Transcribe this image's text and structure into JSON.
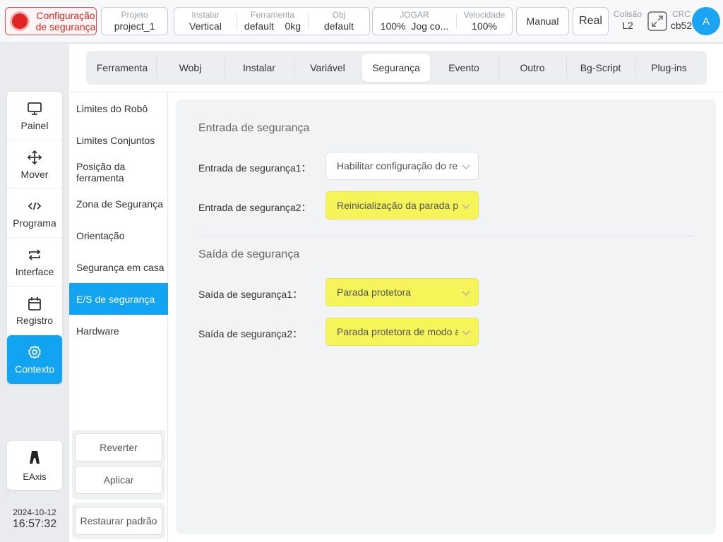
{
  "topbar": {
    "safety_config": "Configuração de segurança",
    "project": {
      "label": "Projeto",
      "value": "project_1"
    },
    "install": {
      "label": "Instalar",
      "value": "Vertical"
    },
    "tool": {
      "label": "Ferramenta",
      "value": "default",
      "load": "0kg"
    },
    "obj": {
      "label": "Obj",
      "value": "default"
    },
    "jog": {
      "label": "JOGAR",
      "percent": "100%",
      "mode": "Jog co..."
    },
    "speed": {
      "label": "Velocidade",
      "value": "100%"
    },
    "mode_button": "Manual",
    "real_button": "Real",
    "collision": {
      "label": "Colisão",
      "value": "L2"
    },
    "crc": {
      "label": "CRC",
      "value": "cb52"
    },
    "avatar": "A",
    "safety_color": "#e02424",
    "accent": "#12a3f1"
  },
  "leftnav": {
    "items": [
      {
        "label": "Painel",
        "icon": "monitor-icon"
      },
      {
        "label": "Mover",
        "icon": "move-arrows-icon"
      },
      {
        "label": "Programa",
        "icon": "code-icon"
      },
      {
        "label": "Interface",
        "icon": "swap-arrows-icon"
      },
      {
        "label": "Registro",
        "icon": "calendar-icon"
      },
      {
        "label": "Contexto",
        "icon": "gear-icon",
        "active": true
      }
    ],
    "eaxis": "EAxis",
    "date": "2024-10-12",
    "time": "16:57:32"
  },
  "tabs": [
    {
      "label": "Ferramenta"
    },
    {
      "label": "Wobj"
    },
    {
      "label": "Instalar"
    },
    {
      "label": "Variável"
    },
    {
      "label": "Segurança",
      "active": true
    },
    {
      "label": "Evento"
    },
    {
      "label": "Outro"
    },
    {
      "label": "Bg-Script"
    },
    {
      "label": "Plug-ins"
    }
  ],
  "submenu": {
    "items": [
      {
        "label": "Limites do Robô"
      },
      {
        "label": "Limites Conjuntos"
      },
      {
        "label": "Posição da ferramenta"
      },
      {
        "label": "Zona de Segurança"
      },
      {
        "label": "Orientação"
      },
      {
        "label": "Segurança em casa"
      },
      {
        "label": "E/S de segurança",
        "active": true
      },
      {
        "label": "Hardware"
      }
    ],
    "revert": "Reverter",
    "apply": "Aplicar",
    "restore": "Restaurar padrão"
  },
  "content": {
    "input_title": "Entrada de segurança",
    "inputs": [
      {
        "label": "Entrada de segurança1：",
        "value": "Habilitar configuração do re",
        "highlight": false
      },
      {
        "label": "Entrada de segurança2：",
        "value": "Reinicialização da parada p",
        "highlight": true
      }
    ],
    "output_title": "Saída de segurança",
    "outputs": [
      {
        "label": "Saída de segurança1：",
        "value": "Parada protetora",
        "highlight": true
      },
      {
        "label": "Saída de segurança2：",
        "value": "Parada protetora de modo a",
        "highlight": true
      }
    ],
    "highlight_color": "#f5f55a"
  }
}
